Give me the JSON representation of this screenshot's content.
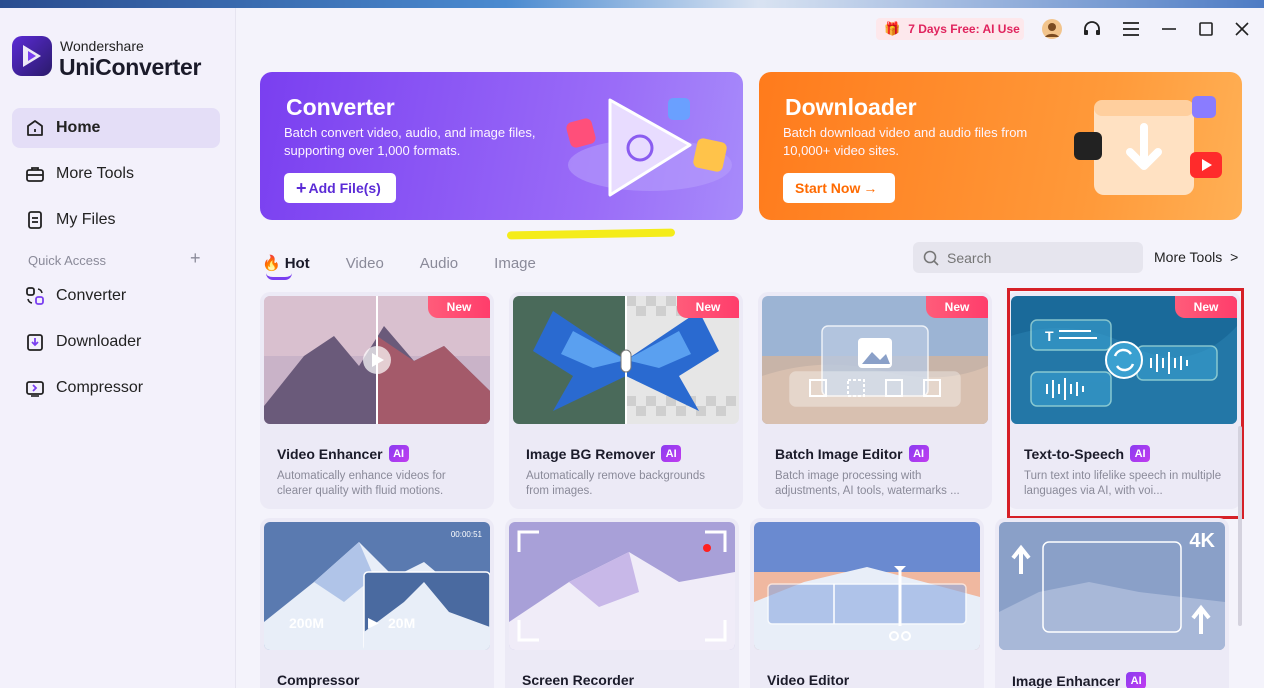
{
  "app": {
    "brand_small": "Wondershare",
    "brand_big": "UniConverter"
  },
  "sidebar": {
    "items": [
      {
        "label": "Home",
        "icon": "home-icon"
      },
      {
        "label": "More Tools",
        "icon": "toolbox-icon"
      },
      {
        "label": "My Files",
        "icon": "file-icon"
      }
    ],
    "quick_access_label": "Quick Access",
    "quick_items": [
      {
        "label": "Converter",
        "icon": "converter-icon"
      },
      {
        "label": "Downloader",
        "icon": "downloader-icon"
      },
      {
        "label": "Compressor",
        "icon": "compressor-icon"
      }
    ]
  },
  "topbar": {
    "promo": "7 Days Free: AI Use"
  },
  "banners": {
    "converter": {
      "title": "Converter",
      "desc": "Batch convert video, audio, and image files, supporting over 1,000 formats.",
      "button": "Add File(s)"
    },
    "downloader": {
      "title": "Downloader",
      "desc": "Batch download video and audio files from 10,000+ video sites.",
      "button": "Start Now"
    }
  },
  "tabs": [
    "Hot",
    "Video",
    "Audio",
    "Image"
  ],
  "search": {
    "placeholder": "Search"
  },
  "more_tools": "More Tools",
  "cards": [
    {
      "title": "Video Enhancer",
      "desc": "Automatically enhance videos for clearer quality with fluid motions.",
      "badge": "New",
      "ai": "AI"
    },
    {
      "title": "Image BG Remover",
      "desc": "Automatically remove backgrounds from images.",
      "badge": "New",
      "ai": "AI"
    },
    {
      "title": "Batch Image Editor",
      "desc": "Batch image processing with adjustments, AI tools, watermarks ...",
      "badge": "New",
      "ai": "AI"
    },
    {
      "title": "Text-to-Speech",
      "desc": "Turn text into lifelike speech in multiple languages via AI, with voi...",
      "badge": "New",
      "ai": "AI"
    },
    {
      "title": "Compressor",
      "size_from": "200M",
      "size_to": "20M",
      "timecode": "00:00:51"
    },
    {
      "title": "Screen Recorder"
    },
    {
      "title": "Video Editor"
    },
    {
      "title": "Image Enhancer",
      "ai": "AI",
      "resolution": "4K"
    }
  ],
  "colors": {
    "accent": "#7a3ff0",
    "promo": "#e0245e",
    "highlight": "#d62027"
  }
}
